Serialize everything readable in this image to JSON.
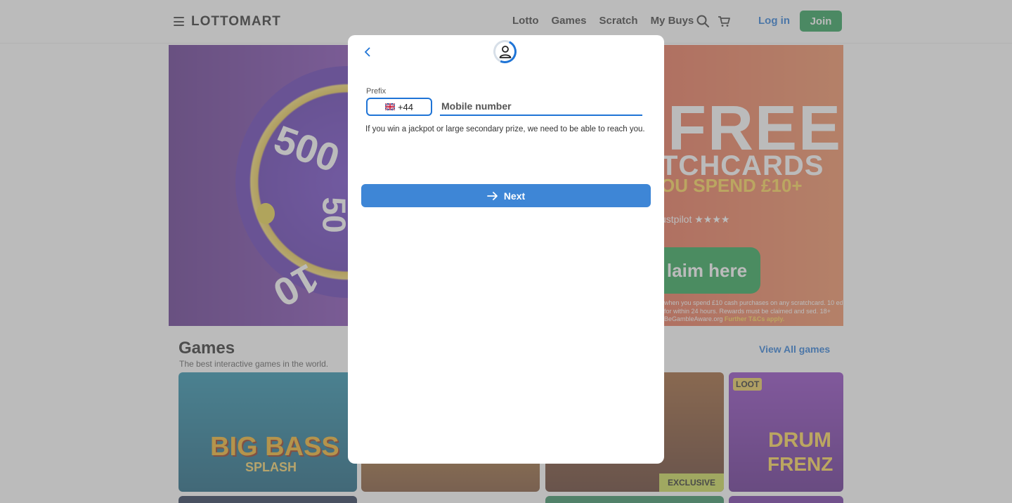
{
  "header": {
    "logo": "LOTTOMART",
    "nav": [
      "Lotto",
      "Games",
      "Scratch",
      "My Buys"
    ],
    "login_label": "Log in",
    "join_label": "Join"
  },
  "banner": {
    "wheel_top": "500",
    "wheel_right": "50",
    "wheel_bottom": "10",
    "free_title": "FREE",
    "free_sub": "TCHCARDS",
    "free_sub2": "OU SPEND £10+",
    "trust_label": "ustpilot ★★★★",
    "claim_label": "laim here",
    "fine_print": "when you spend £10 cash purchases on any scratchcard. 10 ed for within 24 hours. Rewards must be claimed and sed. 18+ BeGambleAware.org",
    "fine_link": "Further T&Cs apply."
  },
  "games": {
    "title": "Games",
    "subtitle": "The best interactive games in the world.",
    "view_all": "View All games",
    "tile1_title": "BIG BASS",
    "tile1_sub": "SPLASH",
    "tile3_badge": "EXCLUSIVE",
    "tile4_badge": "LOOT",
    "tile4_title": "DRUM",
    "tile4_sub": "FRENZ"
  },
  "modal": {
    "prefix_label": "Prefix",
    "prefix_value": "+44",
    "mobile_placeholder": "Mobile number",
    "mobile_value": "",
    "info_text": "If you win a jackpot or large secondary prize, we need to be able to reach you.",
    "next_label": "Next"
  },
  "icons": {
    "menu": "menu-icon",
    "search": "search-icon",
    "cart": "cart-icon",
    "back": "chevron-left-icon",
    "user": "user-icon",
    "flag": "uk-flag-icon",
    "arrow": "arrow-right-icon"
  },
  "colors": {
    "accent": "#1f74d6",
    "join": "#1e9a4e",
    "next_button": "#3e86d6"
  }
}
